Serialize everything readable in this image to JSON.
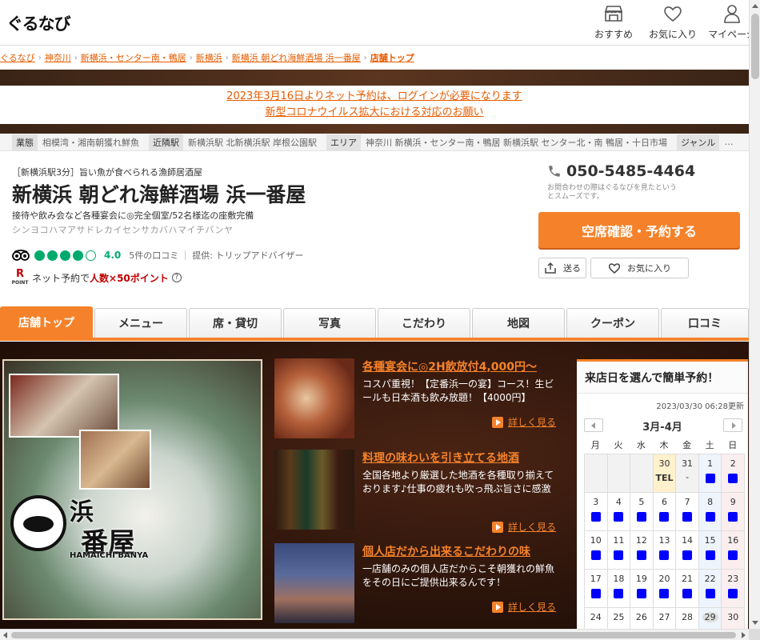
{
  "header": {
    "logo": "ぐるなび",
    "nav": [
      {
        "label": "おすすめ",
        "icon": "shop-icon"
      },
      {
        "label": "お気に入り",
        "icon": "heart-icon"
      },
      {
        "label": "マイページ",
        "icon": "user-icon"
      }
    ]
  },
  "breadcrumb": {
    "items": [
      "ぐるなび",
      "神奈川",
      "新横浜・センター南・鴨居",
      "新横浜",
      "新横浜 朝どれ海鮮酒場 浜一番屋"
    ],
    "current": "店舗トップ"
  },
  "notice": {
    "line1": "2023年3月16日よりネット予約は、ログインが必要になります",
    "line2": "新型コロナウイルス拡大における対応のお願い"
  },
  "infobar": [
    {
      "tag": "業態",
      "value": "相模湾・湘南朝獲れ鮮魚"
    },
    {
      "tag": "近隣駅",
      "value": "新横浜駅 北新横浜駅 岸根公園駅"
    },
    {
      "tag": "エリア",
      "value": "神奈川 新横浜・センター南・鴨居 新横浜駅 センター北・南 鴨居・十日市場"
    },
    {
      "tag": "ジャンル",
      "value": "…"
    }
  ],
  "shop": {
    "catch": "［新横浜駅3分］旨い魚が食べられる漁師居酒屋",
    "name": "新横浜 朝どれ海鮮酒場 浜一番屋",
    "desc": "接待や飲み会など各種宴会に◎完全個室/52名様迄の座敷完備",
    "kana": "シンヨコハマアサドレカイセンサカバハマイチバンヤ",
    "rating": "4.0",
    "rating_value": 4,
    "rating_max": 5,
    "reviews": "5件の口コミ",
    "provider": "提供: トリップアドバイザー",
    "point_prefix": "ネット予約で",
    "point_highlight": "人数×50ポイント",
    "point_logo": "R",
    "point_logo_sub": "POINT"
  },
  "reserve": {
    "phone": "050-5485-4464",
    "note": "お問合わせの際はぐるなびを見たというとスムーズです。",
    "button": "空席確認・予約する",
    "share": "送る",
    "favorite": "お気に入り"
  },
  "tabs": [
    "店舗トップ",
    "メニュー",
    "席・貸切",
    "写真",
    "こだわり",
    "地図",
    "クーポン",
    "口コミ"
  ],
  "hero": {
    "logo_text1": "浜",
    "logo_text2": "番屋",
    "logo_roman": "HAMAICHI BANYA"
  },
  "features": [
    {
      "title": "各種宴会に◎2H飲放付4,000円〜",
      "text": "コスパ重視！【定番浜一の宴】コース！生ビールも日本酒も飲み放題！【4000円】",
      "more": "詳しく見る"
    },
    {
      "title": "料理の味わいを引き立てる地酒",
      "text": "全国各地より厳選した地酒を各種取り揃えております♪仕事の疲れも吹っ飛ぶ旨さに感激",
      "more": "詳しく見る"
    },
    {
      "title": "個人店だから出来るこだわりの味",
      "text": "一店舗のみの個人店だからこそ朝獲れの鮮魚をその日にご提供出来るんです！",
      "more": "詳しく見る"
    }
  ],
  "calendar": {
    "title": "来店日を選んで簡単予約！",
    "updated": "2023/03/30 06:28更新",
    "month": "3月-4月",
    "weekdays": [
      "月",
      "火",
      "水",
      "木",
      "金",
      "土",
      "日"
    ],
    "rows": [
      [
        {
          "d": ""
        },
        {
          "d": ""
        },
        {
          "d": ""
        },
        {
          "d": "30",
          "s": "TEL",
          "today": true
        },
        {
          "d": "31",
          "s": "-"
        },
        {
          "d": "1",
          "m": true
        },
        {
          "d": "2",
          "m": true
        }
      ],
      [
        {
          "d": "3",
          "m": true
        },
        {
          "d": "4",
          "m": true
        },
        {
          "d": "5",
          "m": true
        },
        {
          "d": "6",
          "m": true
        },
        {
          "d": "7",
          "m": true
        },
        {
          "d": "8",
          "m": true
        },
        {
          "d": "9",
          "m": true
        }
      ],
      [
        {
          "d": "10",
          "m": true
        },
        {
          "d": "11",
          "m": true
        },
        {
          "d": "12",
          "m": true
        },
        {
          "d": "13",
          "m": true
        },
        {
          "d": "14",
          "m": true
        },
        {
          "d": "15",
          "m": true
        },
        {
          "d": "16",
          "m": true
        }
      ],
      [
        {
          "d": "17",
          "m": true
        },
        {
          "d": "18",
          "m": true
        },
        {
          "d": "19",
          "m": true
        },
        {
          "d": "20",
          "m": true
        },
        {
          "d": "21",
          "m": true
        },
        {
          "d": "22",
          "m": true
        },
        {
          "d": "23",
          "m": true
        }
      ],
      [
        {
          "d": "24"
        },
        {
          "d": "25"
        },
        {
          "d": "26"
        },
        {
          "d": "27"
        },
        {
          "d": "28"
        },
        {
          "d": "29",
          "tint": true
        },
        {
          "d": "30"
        }
      ]
    ]
  },
  "colors": {
    "accent": "#f5822a",
    "link": "#e65c00",
    "mark": "#0000ff",
    "tripadvisor": "#00aa6c"
  }
}
